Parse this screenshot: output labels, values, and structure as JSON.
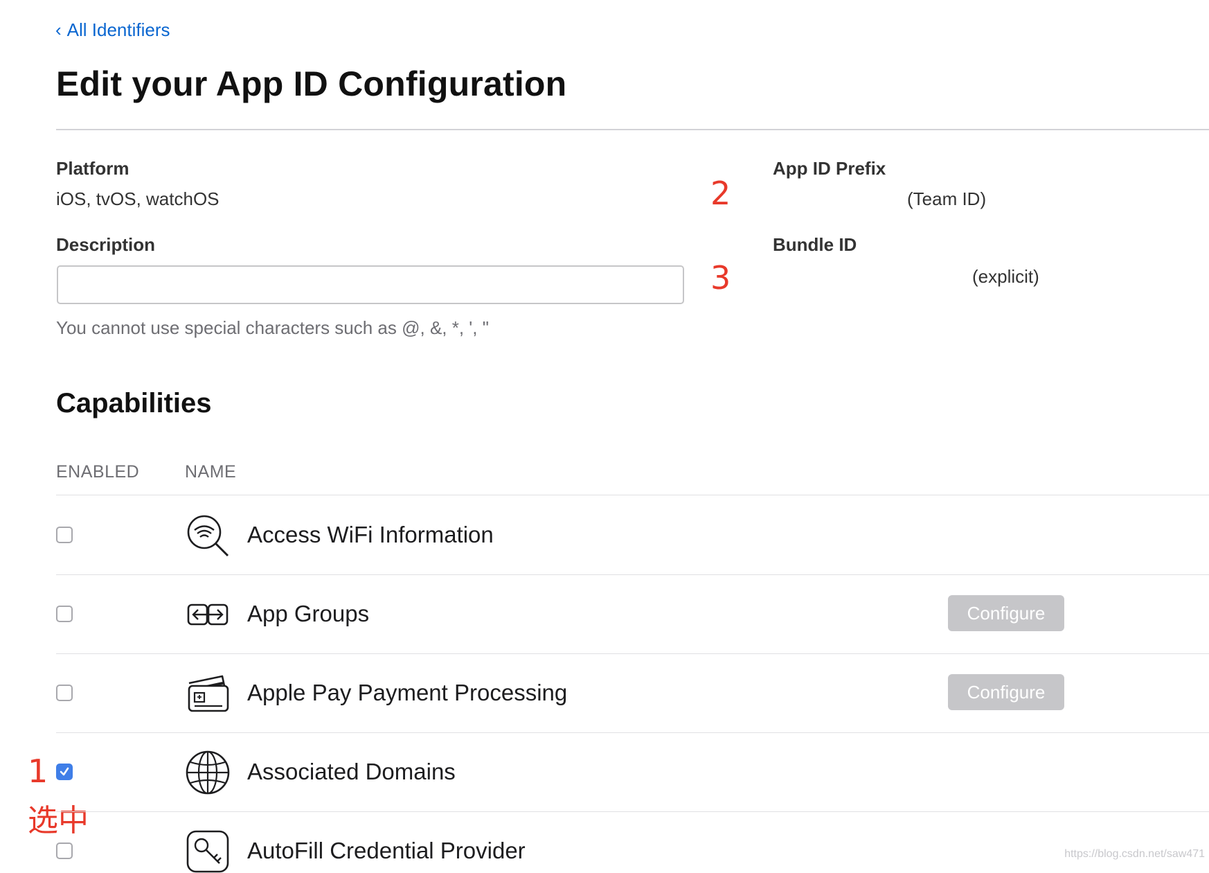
{
  "nav": {
    "back_label": "All Identifiers"
  },
  "page": {
    "title": "Edit your App ID Configuration"
  },
  "details": {
    "platform_label": "Platform",
    "platform_value": "iOS, tvOS, watchOS",
    "description_label": "Description",
    "description_value": "",
    "description_hint": "You cannot use special characters such as @, &, *, ', \"",
    "prefix_label": "App ID Prefix",
    "prefix_value": "(Team ID)",
    "bundle_label": "Bundle ID",
    "bundle_value": "(explicit)"
  },
  "annotations": {
    "a1": "1",
    "a1_text": "选中",
    "a2": "2",
    "a3": "3",
    "color": "#e8392a"
  },
  "capabilities": {
    "title": "Capabilities",
    "col_enabled": "ENABLED",
    "col_name": "NAME",
    "configure_label": "Configure",
    "rows": [
      {
        "name": "Access WiFi Information",
        "enabled": false,
        "icon": "wifi-search-icon",
        "configurable": false
      },
      {
        "name": "App Groups",
        "enabled": false,
        "icon": "app-groups-icon",
        "configurable": true
      },
      {
        "name": "Apple Pay Payment Processing",
        "enabled": false,
        "icon": "payment-card-icon",
        "configurable": true
      },
      {
        "name": "Associated Domains",
        "enabled": true,
        "icon": "globe-icon",
        "configurable": false
      },
      {
        "name": "AutoFill Credential Provider",
        "enabled": false,
        "icon": "key-icon",
        "configurable": false
      }
    ]
  },
  "watermark": "https://blog.csdn.net/saw471",
  "colors": {
    "link": "#0a66d0",
    "checked": "#3f7ee8",
    "button_disabled": "#c6c6c9"
  }
}
